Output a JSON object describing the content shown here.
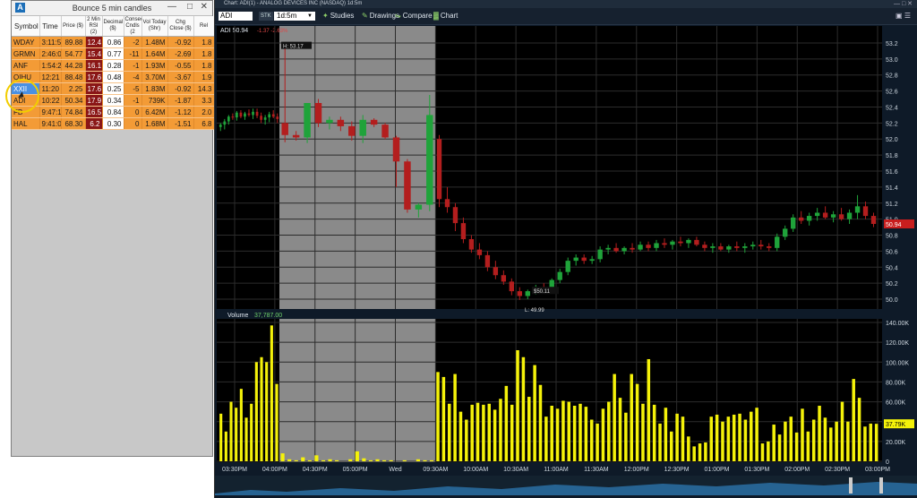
{
  "scanner": {
    "logo": "A",
    "title": "Bounce 5 min candles",
    "columns": [
      "Symbol",
      "Time",
      "Price ($)",
      "2 Min RSI (2)",
      "Decimal ($)",
      "Consec Cndls (2",
      "Vol Today (Shr)",
      "Chg Close ($)",
      "Rel"
    ],
    "rows": [
      {
        "sym": "WDAY",
        "time": "3:11:5",
        "price": "89.88",
        "rsi": "12.4",
        "dec": "0.86",
        "consec": "-2",
        "vol": "1.48M",
        "chg": "-0.92",
        "rel": "1.8"
      },
      {
        "sym": "GRMN",
        "time": "2:46:0",
        "price": "54.77",
        "rsi": "15.4",
        "dec": "0.77",
        "consec": "-11",
        "vol": "1.64M",
        "chg": "-2.69",
        "rel": "1.8"
      },
      {
        "sym": "ANF",
        "time": "1:54:2",
        "price": "44.28",
        "rsi": "16.1",
        "dec": "0.28",
        "consec": "-1",
        "vol": "1.93M",
        "chg": "-0.55",
        "rel": "1.8"
      },
      {
        "sym": "QIHU",
        "time": "12:21",
        "price": "88.48",
        "rsi": "17.6",
        "dec": "0.48",
        "consec": "-4",
        "vol": "3.70M",
        "chg": "-3.67",
        "rel": "1.9"
      },
      {
        "sym": "XXII",
        "time": "11:20",
        "price": "2.25",
        "rsi": "17.6",
        "dec": "0.25",
        "consec": "-5",
        "vol": "1.83M",
        "chg": "-0.92",
        "rel": "14.3"
      },
      {
        "sym": "ADI",
        "time": "10:22",
        "price": "50.34",
        "rsi": "17.9",
        "dec": "0.34",
        "consec": "-1",
        "vol": "739K",
        "chg": "-1.87",
        "rel": "3.3"
      },
      {
        "sym": "FB",
        "time": "9:47:1",
        "price": "74.84",
        "rsi": "16.5",
        "dec": "0.84",
        "consec": "0",
        "vol": "6.42M",
        "chg": "-1.12",
        "rel": "2.0"
      },
      {
        "sym": "HAL",
        "time": "9:41:0",
        "price": "68.30",
        "rsi": "6.2",
        "dec": "0.30",
        "consec": "0",
        "vol": "1.68M",
        "chg": "-1.51",
        "rel": "6.8"
      }
    ],
    "selected_row": 4
  },
  "chart": {
    "window_title": "Chart: ADI(1) - ANALOG DEVICES INC (NASDAQ) 1d:5m",
    "symbol": "ADI",
    "stk": "STK",
    "period": "1d:5m",
    "toolbar": {
      "studies": "Studies",
      "drawings": "Drawings",
      "compare": "Compare",
      "chart": "Chart"
    },
    "header_symbol": "ADI 50.94",
    "header_change": "-1.37 -2.63%",
    "high_label": "H: 53.17",
    "low_label": "L: 49.99",
    "price_marker": "$50.11",
    "last_price": "50.94",
    "volume_label": "Volume",
    "volume_value": "37,787.00",
    "last_volume": "37.79K",
    "colors": {
      "up": "#1fa33a",
      "down": "#b31e1e",
      "volume": "#f5f20a",
      "bg": "#000000",
      "grid": "#2c2c2c",
      "shade": "#8a8a8a"
    }
  },
  "chart_data": {
    "type": "candlestick",
    "price_axis": [
      "53.2",
      "53.0",
      "52.8",
      "52.6",
      "52.4",
      "52.2",
      "52.0",
      "51.8",
      "51.6",
      "51.4",
      "51.2",
      "51.0",
      "50.8",
      "50.6",
      "50.4",
      "50.2",
      "50.0"
    ],
    "volume_axis": [
      "140.00K",
      "120.00K",
      "100.00K",
      "80.00K",
      "60.00K",
      "40.00K",
      "20.00K",
      "0"
    ],
    "time_axis": [
      "03:30PM",
      "04:00PM",
      "04:30PM",
      "05:00PM",
      "Wed",
      "09:30AM",
      "10:00AM",
      "10:30AM",
      "11:00AM",
      "11:30AM",
      "12:00PM",
      "12:30PM",
      "01:00PM",
      "01:30PM",
      "02:00PM",
      "02:30PM",
      "03:00PM"
    ],
    "ylim": [
      49.9,
      53.3
    ],
    "volume_max": 140000,
    "candles_prev_close": [
      [
        52.15,
        52.2,
        52.1,
        52.18
      ],
      [
        52.18,
        52.25,
        52.12,
        52.22
      ],
      [
        52.22,
        52.3,
        52.18,
        52.28
      ],
      [
        52.28,
        52.32,
        52.24,
        52.27
      ],
      [
        52.27,
        52.35,
        52.23,
        52.33
      ],
      [
        52.33,
        52.36,
        52.26,
        52.28
      ],
      [
        52.28,
        52.34,
        52.24,
        52.32
      ],
      [
        52.32,
        52.37,
        52.28,
        52.3
      ],
      [
        52.3,
        52.38,
        52.25,
        52.34
      ],
      [
        52.34,
        52.38,
        52.26,
        52.29
      ],
      [
        52.29,
        52.33,
        52.2,
        52.24
      ],
      [
        52.24,
        52.3,
        52.18,
        52.27
      ],
      [
        52.27,
        52.34,
        52.21,
        52.31
      ],
      [
        52.31,
        52.36,
        52.26,
        52.28
      ],
      [
        52.28,
        52.32,
        52.2,
        52.25
      ]
    ],
    "candles_after_hours": [
      [
        52.2,
        53.17,
        51.96,
        52.05
      ],
      [
        52.05,
        52.1,
        51.98,
        52.02
      ],
      [
        52.02,
        52.18,
        51.95,
        52.45
      ],
      [
        52.45,
        52.5,
        52.15,
        52.2
      ],
      [
        52.2,
        52.28,
        52.12,
        52.24
      ],
      [
        52.24,
        52.28,
        52.1,
        52.16
      ],
      [
        52.16,
        52.22,
        51.98,
        52.04
      ],
      [
        52.04,
        52.3,
        51.95,
        52.24
      ],
      [
        52.24,
        52.26,
        52.15,
        52.18
      ],
      [
        52.18,
        52.2,
        52.0,
        52.02
      ],
      [
        52.02,
        52.04,
        51.4,
        51.72
      ],
      [
        51.72,
        51.75,
        51.08,
        51.12
      ],
      [
        51.12,
        51.2,
        51.02,
        51.18
      ],
      [
        51.18,
        52.55,
        51.1,
        52.3
      ]
    ],
    "candles_session": [
      [
        52.0,
        52.05,
        51.15,
        51.25
      ],
      [
        51.25,
        51.4,
        51.08,
        51.15
      ],
      [
        51.15,
        51.2,
        50.85,
        50.95
      ],
      [
        50.95,
        51.02,
        50.7,
        50.75
      ],
      [
        50.75,
        50.8,
        50.58,
        50.62
      ],
      [
        50.62,
        50.7,
        50.5,
        50.55
      ],
      [
        50.55,
        50.6,
        50.35,
        50.4
      ],
      [
        50.4,
        50.48,
        50.25,
        50.3
      ],
      [
        50.3,
        50.36,
        50.18,
        50.22
      ],
      [
        50.22,
        50.26,
        50.05,
        50.1
      ],
      [
        50.1,
        50.15,
        49.99,
        50.04
      ],
      [
        50.04,
        50.12,
        50.0,
        50.1
      ],
      [
        50.1,
        50.18,
        50.06,
        50.14
      ],
      [
        50.14,
        50.2,
        50.08,
        50.11
      ],
      [
        50.11,
        50.26,
        50.08,
        50.24
      ],
      [
        50.24,
        50.38,
        50.2,
        50.34
      ],
      [
        50.34,
        50.52,
        50.3,
        50.48
      ],
      [
        50.48,
        50.56,
        50.42,
        50.52
      ],
      [
        50.52,
        50.56,
        50.44,
        50.48
      ],
      [
        50.48,
        50.54,
        50.44,
        50.5
      ],
      [
        50.5,
        50.66,
        50.46,
        50.62
      ],
      [
        50.62,
        50.68,
        50.56,
        50.64
      ],
      [
        50.64,
        50.7,
        50.58,
        50.6
      ],
      [
        50.6,
        50.66,
        50.56,
        50.64
      ],
      [
        50.64,
        50.7,
        50.58,
        50.62
      ],
      [
        50.62,
        50.72,
        50.6,
        50.68
      ],
      [
        50.68,
        50.72,
        50.6,
        50.64
      ],
      [
        50.64,
        50.74,
        50.6,
        50.7
      ],
      [
        50.7,
        50.76,
        50.64,
        50.68
      ],
      [
        50.68,
        50.74,
        50.62,
        50.72
      ],
      [
        50.72,
        50.78,
        50.66,
        50.7
      ],
      [
        50.7,
        50.76,
        50.64,
        50.74
      ],
      [
        50.74,
        50.78,
        50.66,
        50.68
      ],
      [
        50.68,
        50.72,
        50.6,
        50.64
      ],
      [
        50.64,
        50.7,
        50.58,
        50.66
      ],
      [
        50.66,
        50.7,
        50.6,
        50.62
      ],
      [
        50.62,
        50.68,
        50.58,
        50.66
      ],
      [
        50.66,
        50.72,
        50.6,
        50.64
      ],
      [
        50.64,
        50.7,
        50.58,
        50.66
      ],
      [
        50.66,
        50.72,
        50.62,
        50.68
      ],
      [
        50.68,
        50.74,
        50.62,
        50.66
      ],
      [
        50.66,
        50.7,
        50.6,
        50.64
      ],
      [
        50.64,
        50.82,
        50.6,
        50.78
      ],
      [
        50.78,
        50.92,
        50.74,
        50.88
      ],
      [
        50.88,
        51.06,
        50.84,
        51.02
      ],
      [
        51.02,
        51.1,
        50.94,
        50.98
      ],
      [
        50.98,
        51.08,
        50.92,
        51.04
      ],
      [
        51.04,
        51.14,
        50.98,
        51.08
      ],
      [
        51.08,
        51.16,
        51.0,
        51.02
      ],
      [
        51.02,
        51.1,
        50.96,
        51.06
      ],
      [
        51.06,
        51.14,
        50.98,
        51.0
      ],
      [
        51.0,
        51.12,
        50.94,
        51.08
      ],
      [
        51.08,
        51.3,
        51.0,
        51.16
      ],
      [
        51.16,
        51.22,
        51.0,
        51.04
      ],
      [
        51.04,
        51.08,
        50.9,
        50.94
      ]
    ],
    "volume_prev_close": [
      48000,
      30000,
      60000,
      54000,
      73000,
      44000,
      58000,
      100000,
      105000,
      100000,
      137000,
      78000
    ],
    "volume_after_hours": [
      8000,
      2000,
      1000,
      4000,
      1000,
      6000,
      1000,
      2000,
      1000,
      0,
      2000,
      10000,
      3000,
      1000,
      2000,
      1000,
      1000,
      0,
      1000,
      0,
      2000,
      1000,
      1000
    ],
    "volume_session": [
      90000,
      85000,
      58000,
      88000,
      50000,
      42000,
      57000,
      59000,
      57000,
      58000,
      52000,
      63000,
      76000,
      57000,
      112000,
      105000,
      65000,
      97000,
      77000,
      45000,
      56000,
      53000,
      61000,
      60000,
      56000,
      58000,
      55000,
      42000,
      38000,
      53000,
      60000,
      88000,
      64000,
      49000,
      88000,
      78000,
      58000,
      103000,
      57000,
      38000,
      54000,
      30000,
      48000,
      45000,
      25000,
      15000,
      18000,
      19000,
      45000,
      47000,
      40000,
      45000,
      47000,
      48000,
      42000,
      50000,
      54000,
      18000,
      20000,
      37000,
      27000,
      40000,
      45000,
      29000,
      53000,
      30000,
      42000,
      56000,
      44000,
      34000,
      40000,
      60000,
      40000,
      83000,
      64000,
      35000,
      38000,
      37790
    ]
  }
}
